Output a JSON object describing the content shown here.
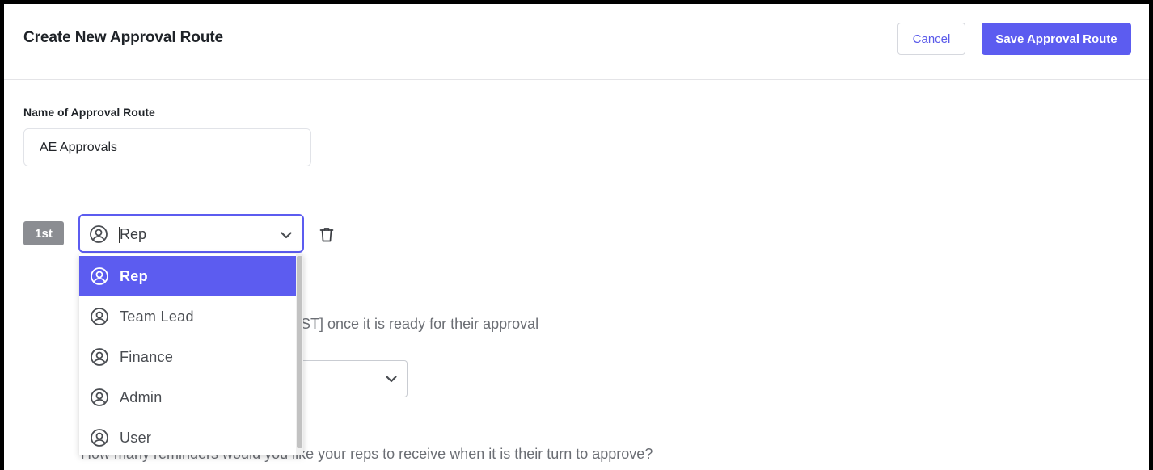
{
  "header": {
    "title": "Create New Approval Route",
    "cancel_label": "Cancel",
    "save_label": "Save Approval Route"
  },
  "name_field": {
    "label": "Name of Approval Route",
    "value": "AE Approvals"
  },
  "step": {
    "badge": "1st",
    "selected_role": "Rep",
    "options": [
      {
        "label": "Rep",
        "selected": true
      },
      {
        "label": "Team Lead",
        "selected": false
      },
      {
        "label": "Finance",
        "selected": false
      },
      {
        "label": "Admin",
        "selected": false
      },
      {
        "label": "User",
        "selected": false
      }
    ]
  },
  "background": {
    "notify_text_fragment": "PST] once it is ready for their approval",
    "reminders_question": "How many reminders would you like your reps to receive when it is their turn to approve?"
  },
  "colors": {
    "accent": "#5c5cf0",
    "badge": "#8b8d92",
    "text_dark": "#1f2328",
    "text_muted": "#6b6e74"
  },
  "icons": {
    "role": "user-circle-icon",
    "dropdown": "chevron-down-icon",
    "delete": "trash-icon"
  }
}
